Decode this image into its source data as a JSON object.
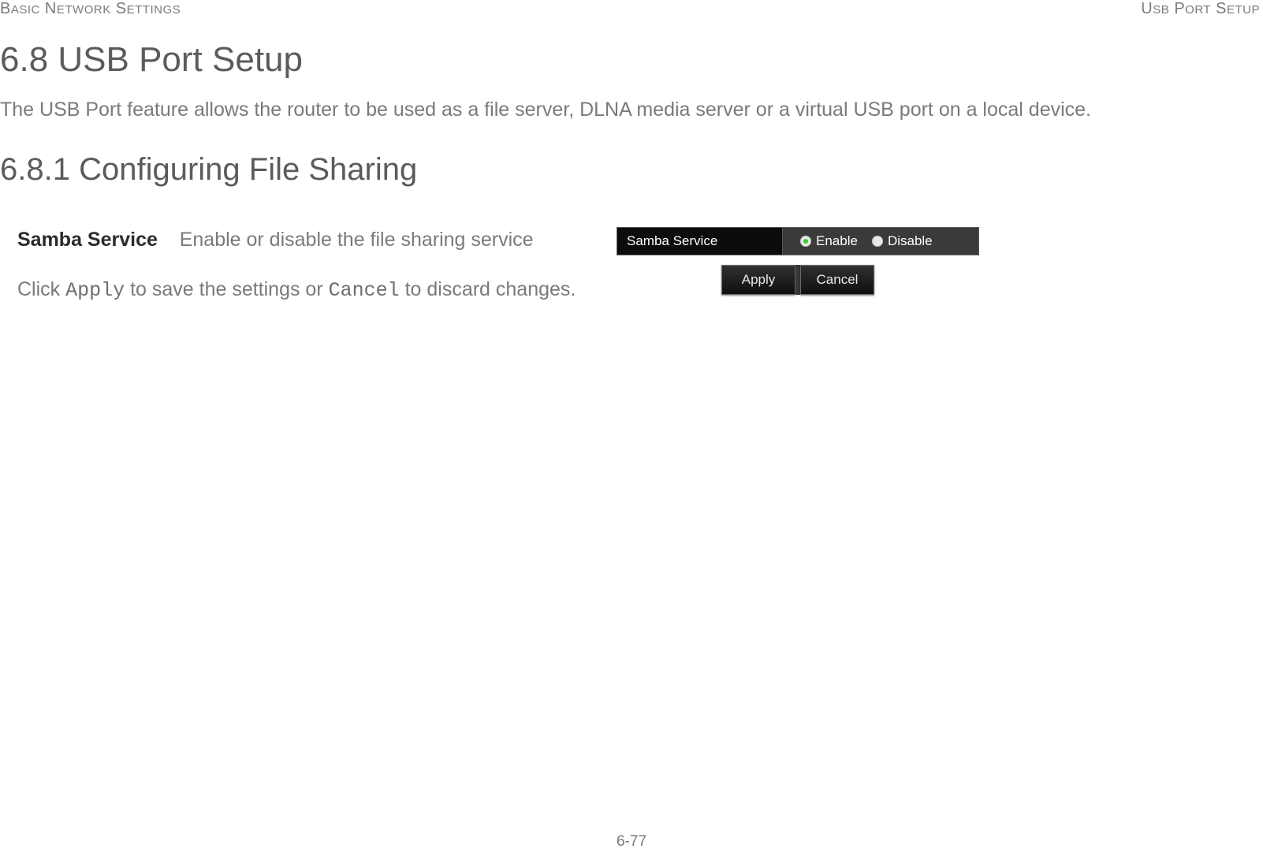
{
  "header": {
    "left": "Basic Network Settings",
    "right": "USB Port Setup"
  },
  "section": {
    "title": "6.8 USB Port Setup",
    "intro": "The USB Port feature allows the router to be used as a file server, DLNA media server or a virtual USB port on a local device."
  },
  "subsection": {
    "title": "6.8.1 Configuring File Sharing"
  },
  "desc": {
    "label": "Samba Service",
    "text": "Enable or disable the file sharing service"
  },
  "apply_sentence": {
    "pre": "Click ",
    "apply": "Apply",
    "mid": " to save the settings or ",
    "cancel": "Cancel",
    "post": " to discard changes."
  },
  "router_ui": {
    "row_label": "Samba Service",
    "options": {
      "enable": "Enable",
      "disable": "Disable",
      "selected": "enable"
    },
    "buttons": {
      "apply": "Apply",
      "cancel": "Cancel"
    }
  },
  "footer": {
    "page_number": "6-77"
  }
}
